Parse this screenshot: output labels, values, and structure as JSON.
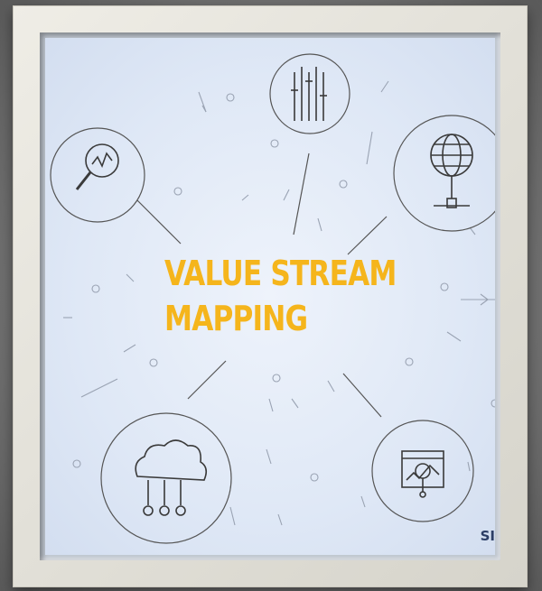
{
  "title": {
    "line1": "VALUE STREAM",
    "line2": "MAPPING"
  },
  "logo_text": "SI",
  "colors": {
    "title": "#f5b51c",
    "background": "#dfe8f6",
    "icon_stroke": "#3a3a3a",
    "frame": "#e8e6de"
  },
  "icons": [
    "magnifier-chart-icon",
    "equalizer-icon",
    "globe-network-icon",
    "cloud-network-icon",
    "browser-analytics-icon"
  ]
}
